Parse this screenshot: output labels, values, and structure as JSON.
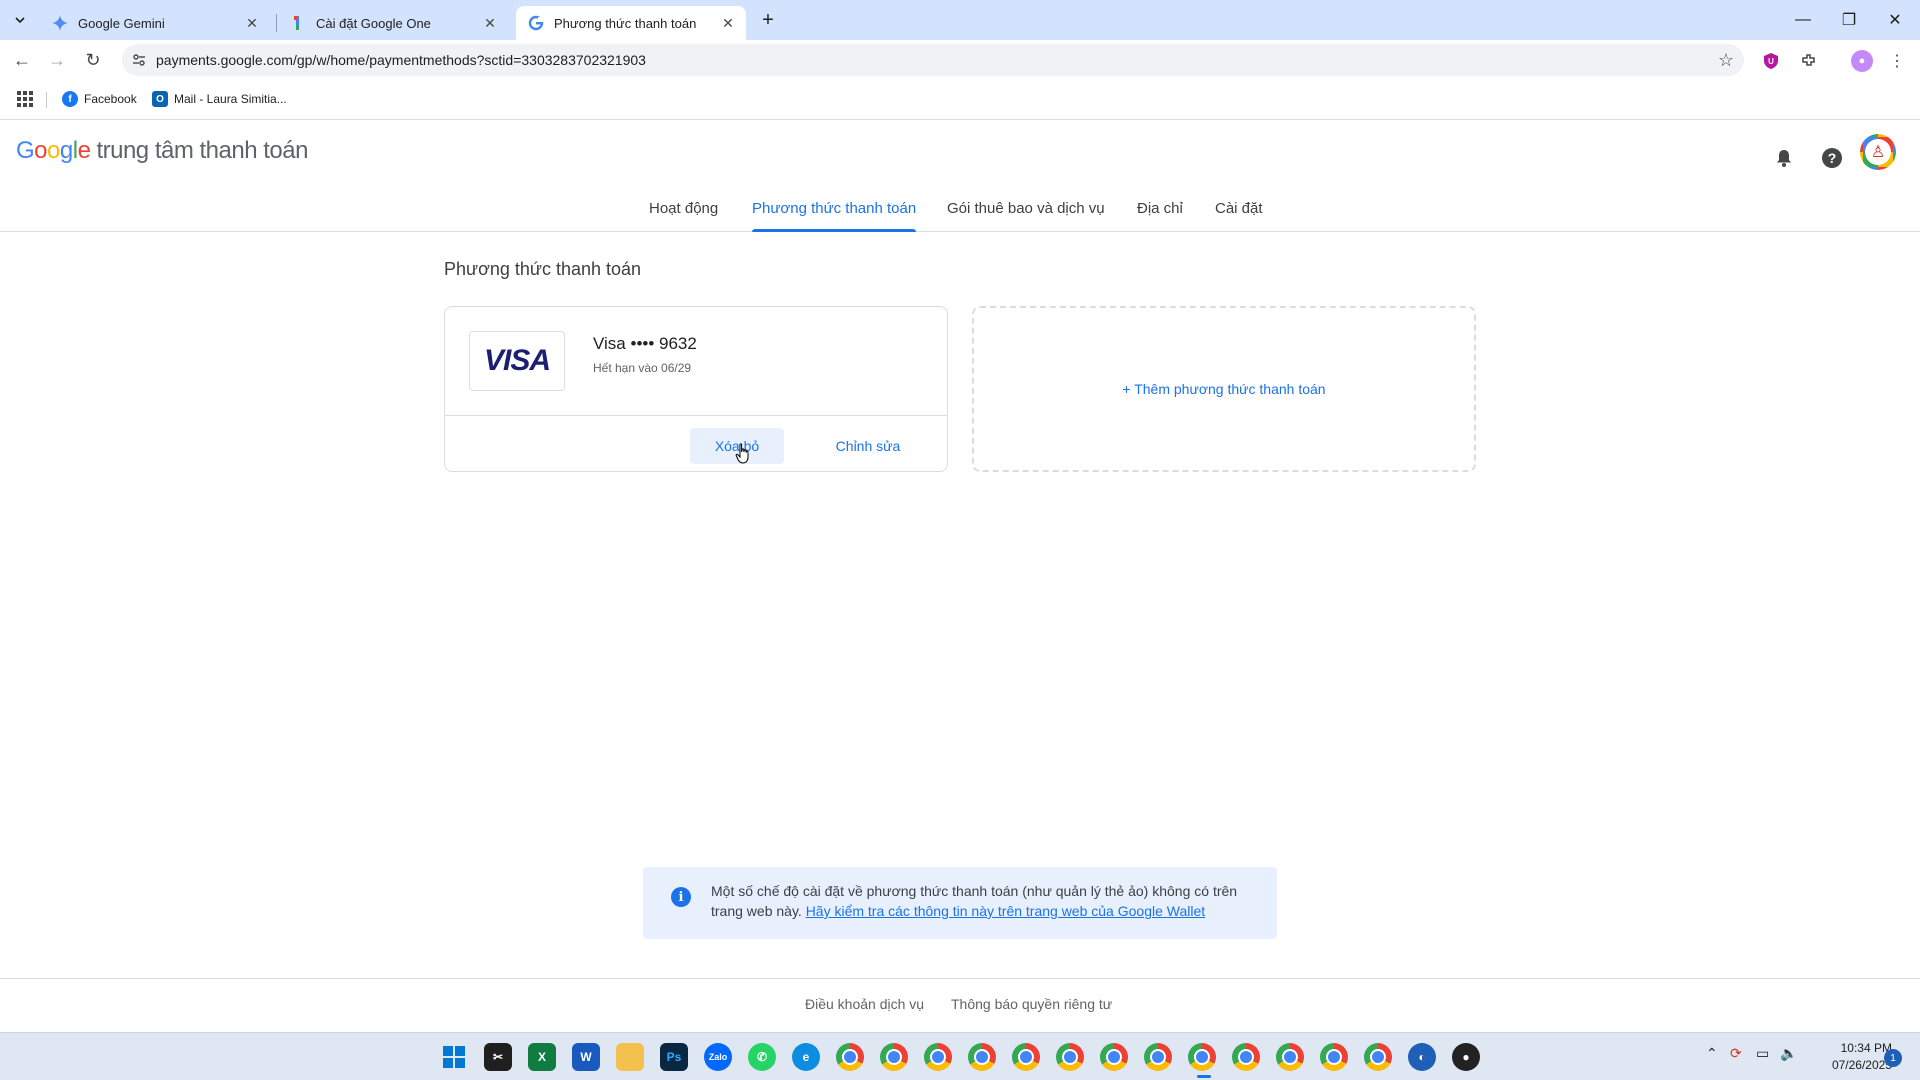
{
  "browser": {
    "tabs": [
      {
        "title": "Google Gemini",
        "icon": "gemini-icon"
      },
      {
        "title": "Cài đặt Google One",
        "icon": "google-one-icon"
      },
      {
        "title": "Phương thức thanh toán",
        "icon": "google-icon"
      }
    ],
    "url": "payments.google.com/gp/w/home/paymentmethods?sctid=3303283702321903",
    "bookmarks": [
      {
        "label": "Facebook",
        "icon": "facebook-icon"
      },
      {
        "label": "Mail - Laura Simitia...",
        "icon": "outlook-icon"
      }
    ]
  },
  "header": {
    "logo_letters": [
      "G",
      "o",
      "o",
      "g",
      "l",
      "e"
    ],
    "product": "trung tâm thanh toán"
  },
  "nav": {
    "tabs": [
      "Hoạt động",
      "Phương thức thanh toán",
      "Gói thuê bao và dịch vụ",
      "Địa chỉ",
      "Cài đặt"
    ],
    "active": "Phương thức thanh toán"
  },
  "main": {
    "title": "Phương thức thanh toán",
    "card": {
      "brand_logo": "VISA",
      "name": "Visa •••• 9632",
      "expiry": "Hết hạn vào 06/29",
      "remove_label": "Xóa bỏ",
      "edit_label": "Chỉnh sửa"
    },
    "add_label": "+ Thêm phương thức thanh toán"
  },
  "notice": {
    "text": "Một số chế độ cài đặt về phương thức thanh toán (như quản lý thẻ ảo) không có trên trang web này.",
    "link": "Hãy kiểm tra các thông tin này trên trang web của Google Wallet"
  },
  "footer": {
    "terms": "Điều khoản dịch vụ",
    "privacy": "Thông báo quyền riêng tư"
  },
  "taskbar": {
    "time": "10:34 PM",
    "date": "07/26/2025",
    "notification_count": "1"
  },
  "colors": {
    "accent": "#1a73e8",
    "tabbar": "#d3e3fd",
    "notice_bg": "#e8f0fe"
  }
}
